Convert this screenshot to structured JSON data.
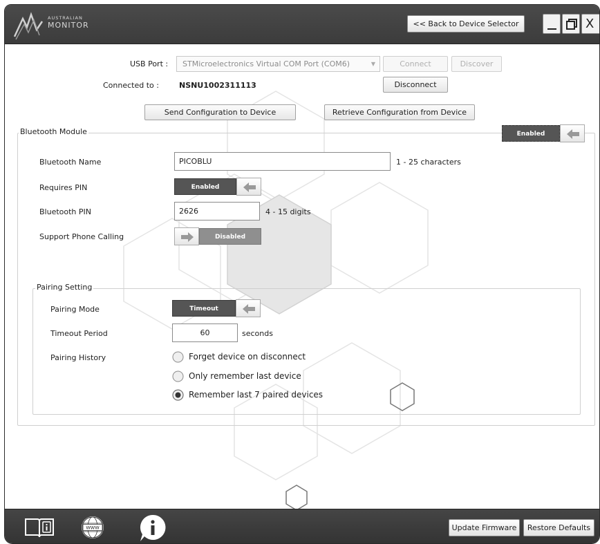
{
  "app": {
    "logo_top": "AUSTRALIAN",
    "logo_bottom": "MONITOR",
    "back_button": "<< Back to Device Selector",
    "window_buttons": [
      "minimize-icon",
      "restore-icon",
      "close-icon"
    ],
    "close_glyph": "X"
  },
  "connection": {
    "usb_port_label": "USB Port :",
    "usb_port_value": "STMicroelectronics Virtual COM Port (COM6)",
    "connect_button": "Connect",
    "discover_button": "Discover",
    "connected_to_label": "Connected to :",
    "connected_to_value": "NSNU1002311113",
    "disconnect_button": "Disconnect",
    "send_button": "Send Configuration to Device",
    "retrieve_button": "Retrieve Configuration from Device"
  },
  "bluetooth": {
    "group_title": "Bluetooth Module",
    "module_toggle": "Enabled",
    "name_label": "Bluetooth Name",
    "name_value": "PICOBLU",
    "name_hint": "1 - 25 characters",
    "requires_pin_label": "Requires PIN",
    "requires_pin_toggle": "Enabled",
    "pin_label": "Bluetooth PIN",
    "pin_value": "2626",
    "pin_hint": "4 - 15 digits",
    "phone_calling_label": "Support Phone Calling",
    "phone_calling_toggle": "Disabled"
  },
  "pairing": {
    "group_title": "Pairing Setting",
    "mode_label": "Pairing Mode",
    "mode_toggle": "Timeout",
    "timeout_label": "Timeout Period",
    "timeout_value": "60",
    "timeout_unit": "seconds",
    "history_label": "Pairing History",
    "history_options": [
      "Forget device on disconnect",
      "Only remember last device",
      "Remember last 7 paired devices"
    ],
    "history_selected_index": 2
  },
  "footer": {
    "icons": [
      "manual-book-icon",
      "www-globe-icon",
      "info-icon"
    ],
    "www_text": "WWW",
    "update_button": "Update Firmware",
    "restore_button": "Restore Defaults"
  },
  "colors": {
    "titlebar": "#3c3c3c",
    "toggle_on": "#555555",
    "toggle_off": "#8f8f8f"
  }
}
